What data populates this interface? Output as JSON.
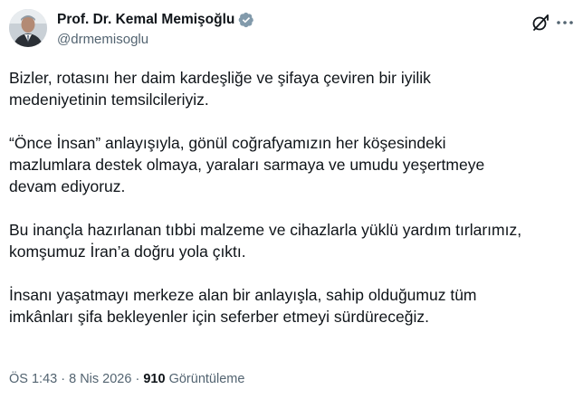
{
  "author": {
    "display_name": "Prof. Dr. Kemal Memişoğlu",
    "handle": "@drmemisoglu",
    "verified_icon": "verified-badge-icon",
    "avatar_icon": "avatar"
  },
  "header_actions": {
    "grok_icon": "grok-icon",
    "more_icon": "more-horizontal-icon"
  },
  "content": {
    "paragraphs": [
      "Bizler, rotasını her daim kardeşliğe ve şifaya çeviren bir iyilik\nmedeniyetinin temsilcileriyiz.",
      "“Önce İnsan” anlayışıyla, gönül coğrafyamızın her köşesindeki\nmazlumlara destek olmaya, yaraları sarmaya ve umudu yeşertmeye\ndevam ediyoruz.",
      "Bu inançla hazırlanan tıbbi malzeme ve cihazlarla yüklü yardım tırlarımız,\nkomşumuz İran’a doğru yola çıktı.",
      "İnsanı yaşatmayı merkeze alan bir anlayışla, sahip olduğumuz tüm\nimkânları şifa bekleyenler için seferber etmeyi sürdüreceğiz."
    ]
  },
  "meta": {
    "time": "ÖS 1:43",
    "separator": "·",
    "date": "8 Nis 2026",
    "views_count": "910",
    "views_label": "Görüntüleme"
  },
  "colors": {
    "text_primary": "#0f1419",
    "text_secondary": "#536471",
    "verified_gray": "#829aab"
  }
}
